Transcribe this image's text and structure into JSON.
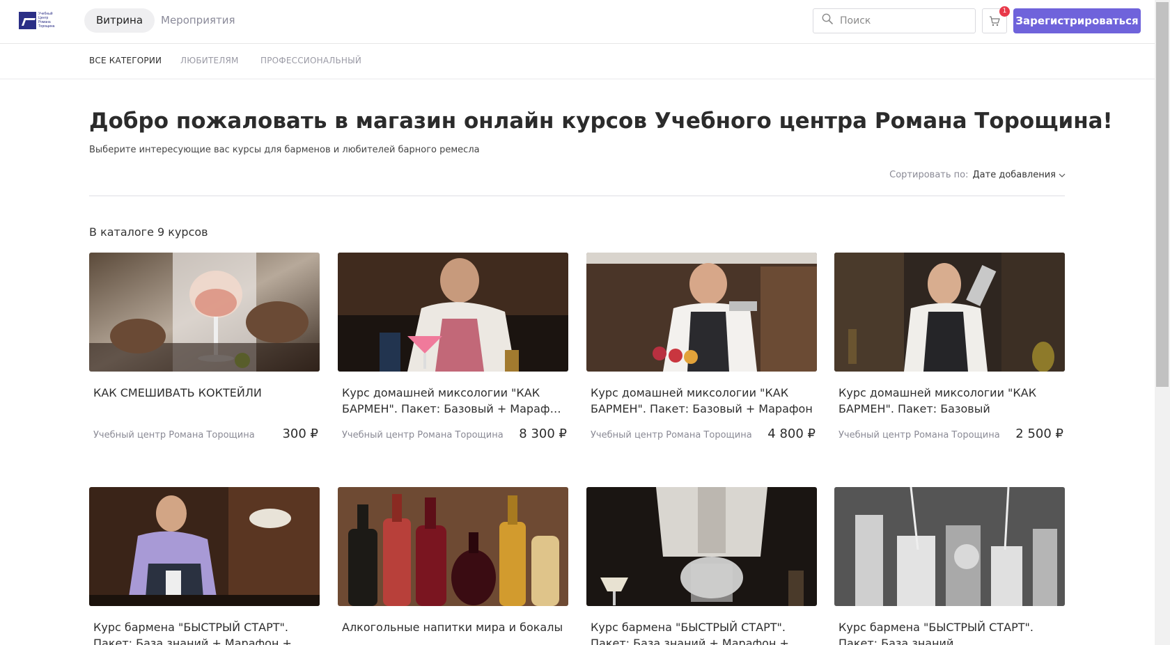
{
  "brand": {
    "logo_lines": [
      "Учебный",
      "Центр",
      "Романа",
      "Торощина"
    ]
  },
  "header": {
    "tabs": [
      {
        "label": "Витрина",
        "active": true
      },
      {
        "label": "Мероприятия",
        "active": false
      }
    ],
    "search_placeholder": "Поиск",
    "cart_count": "1",
    "register_label": "Зарегистрироваться",
    "accent_color": "#6f63db",
    "badge_color": "#e8394a"
  },
  "categories": [
    {
      "label": "ВСЕ КАТЕГОРИИ",
      "active": true
    },
    {
      "label": "ЛЮБИТЕЛЯМ",
      "active": false
    },
    {
      "label": "ПРОФЕССИОНАЛЬНЫЙ",
      "active": false
    }
  ],
  "main": {
    "title": "Добро пожаловать в магазин онлайн курсов Учебного центра Романа Торощина!",
    "subtitle": "Выберите интересующие вас курсы для барменов и любителей барного ремесла",
    "sort_label": "Сортировать по:",
    "sort_value": "Дате добавления",
    "catalog_count": "В каталоге 9 курсов"
  },
  "courses": [
    {
      "title": "КАК СМЕШИВАТЬ КОКТЕЙЛИ",
      "author": "Учебный центр Романа Торощина",
      "price": "300 ₽",
      "image": "bartender-gin-tonic-photo"
    },
    {
      "title": "Курс домашней миксологии \"КАК БАРМЕН\". Пакет: Базовый + Марафон + Набор инструментов",
      "author": "Учебный центр Романа Торощина",
      "price": "8 300 ₽",
      "image": "bartender-straining-cocktail-photo"
    },
    {
      "title": "Курс домашней миксологии \"КАК БАРМЕН\". Пакет: Базовый + Марафон",
      "author": "Учебный центр Романа Торощина",
      "price": "4 800 ₽",
      "image": "bartender-pouring-drinks-photo"
    },
    {
      "title": "Курс домашней миксологии \"КАК БАРМЕН\". Пакет: Базовый",
      "author": "Учебный центр Романа Торощина",
      "price": "2 500 ₽",
      "image": "bartender-shaker-photo"
    },
    {
      "title": "Курс бармена \"БЫСТРЫЙ СТАРТ\". Пакет: База знаний + Марафон + Набор инструментов",
      "author": "",
      "price": "",
      "image": "bartender-garnishing-photo"
    },
    {
      "title": "Алкогольные напитки мира и бокалы",
      "author": "",
      "price": "",
      "image": "liquor-bottles-photo"
    },
    {
      "title": "Курс бармена \"БЫСТРЫЙ СТАРТ\". Пакет: База знаний + Марафон + Набор инструментов",
      "author": "",
      "price": "",
      "image": "bartender-smoke-cocktail-photo"
    },
    {
      "title": "Курс бармена \"БЫСТРЫЙ СТАРТ\". Пакет: База знаний",
      "author": "",
      "price": "",
      "image": "bar-tools-bw-photo"
    }
  ]
}
